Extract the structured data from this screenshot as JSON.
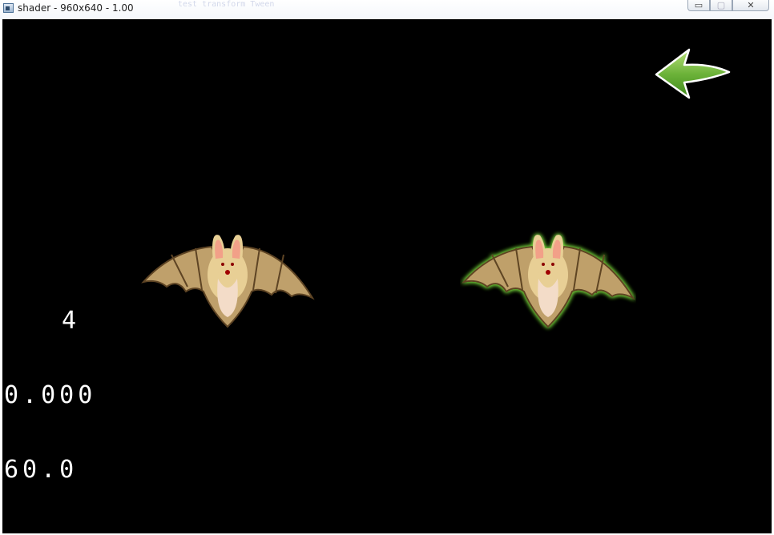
{
  "window": {
    "title": "shader - 960x640 - 1.00",
    "background_text": "test transform Tween",
    "controls": {
      "minimize_symbol": "▭",
      "maximize_symbol": "▢",
      "close_symbol": "✕"
    }
  },
  "scene": {
    "background_color": "#000000",
    "back_arrow_icon": "green-back-arrow-icon",
    "sprites": [
      {
        "name": "bat",
        "effect": "none"
      },
      {
        "name": "bat",
        "effect": "outline-glow"
      }
    ]
  },
  "stats": {
    "draw_calls": "4",
    "frame_time": "0.000",
    "fps": "60.0"
  },
  "colors": {
    "glow": "#7adf3e",
    "arrow_green": "#5aa62a",
    "bat_body": "#e6c98a",
    "bat_wing": "#b89a64"
  }
}
